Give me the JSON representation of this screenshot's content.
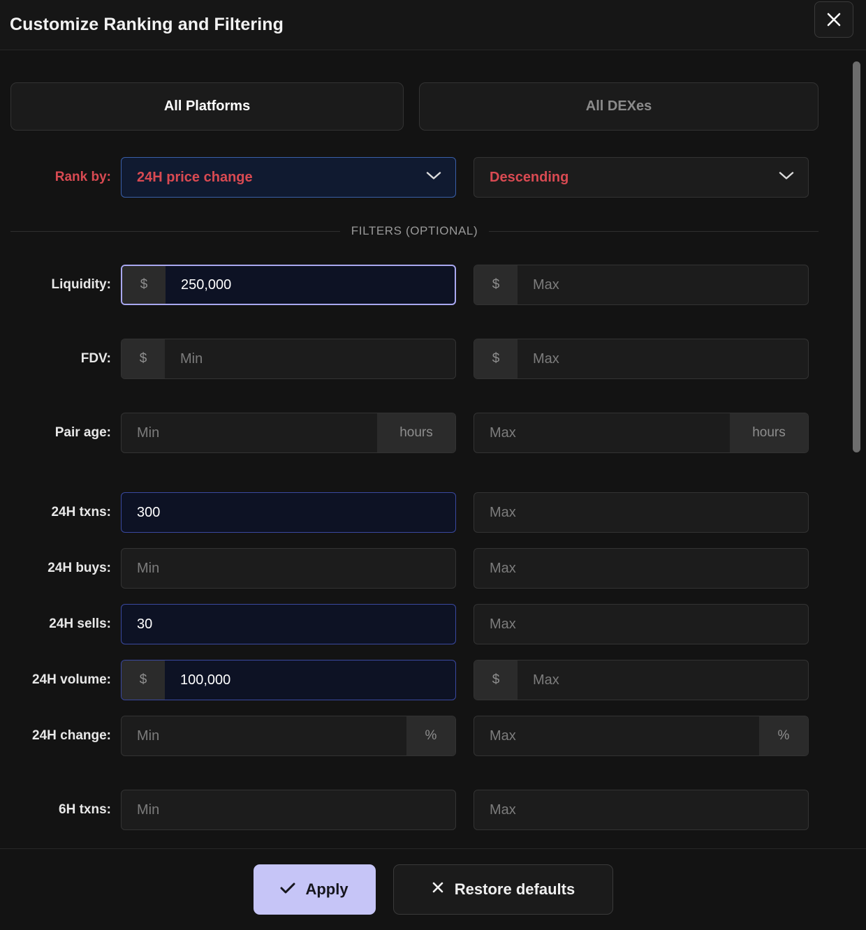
{
  "header": {
    "title": "Customize Ranking and Filtering",
    "close_icon": "close-icon"
  },
  "tabs": [
    {
      "label": "All Platforms",
      "selected": true
    },
    {
      "label": "All DEXes",
      "selected": false
    }
  ],
  "rank": {
    "label": "Rank by:",
    "metric_value": "24H price change",
    "direction_value": "Descending",
    "chevron_icon": "chevron-down-icon"
  },
  "filters_divider": "FILTERS (OPTIONAL)",
  "filters": [
    {
      "label": "Liquidity:",
      "min": {
        "prefix": "$",
        "value": "250,000",
        "placeholder": "Min",
        "state": "focused"
      },
      "max": {
        "prefix": "$",
        "value": "",
        "placeholder": "Max",
        "state": "empty"
      }
    },
    {
      "label": "FDV:",
      "min": {
        "prefix": "$",
        "value": "",
        "placeholder": "Min",
        "state": "empty"
      },
      "max": {
        "prefix": "$",
        "value": "",
        "placeholder": "Max",
        "state": "empty"
      }
    },
    {
      "label": "Pair age:",
      "min": {
        "suffix": "hours",
        "value": "",
        "placeholder": "Min",
        "state": "empty"
      },
      "max": {
        "suffix": "hours",
        "value": "",
        "placeholder": "Max",
        "state": "empty"
      }
    },
    {
      "label": "24H txns:",
      "min": {
        "value": "300",
        "placeholder": "Min",
        "state": "filled"
      },
      "max": {
        "value": "",
        "placeholder": "Max",
        "state": "empty"
      }
    },
    {
      "label": "24H buys:",
      "min": {
        "value": "",
        "placeholder": "Min",
        "state": "empty"
      },
      "max": {
        "value": "",
        "placeholder": "Max",
        "state": "empty"
      }
    },
    {
      "label": "24H sells:",
      "min": {
        "value": "30",
        "placeholder": "Min",
        "state": "filled"
      },
      "max": {
        "value": "",
        "placeholder": "Max",
        "state": "empty"
      }
    },
    {
      "label": "24H volume:",
      "min": {
        "prefix": "$",
        "value": "100,000",
        "placeholder": "Min",
        "state": "filled"
      },
      "max": {
        "prefix": "$",
        "value": "",
        "placeholder": "Max",
        "state": "empty"
      }
    },
    {
      "label": "24H change:",
      "min": {
        "suffix": "%",
        "value": "",
        "placeholder": "Min",
        "state": "empty"
      },
      "max": {
        "suffix": "%",
        "value": "",
        "placeholder": "Max",
        "state": "empty"
      }
    },
    {
      "label": "6H txns:",
      "min": {
        "value": "",
        "placeholder": "Min",
        "state": "empty"
      },
      "max": {
        "value": "",
        "placeholder": "Max",
        "state": "empty"
      }
    }
  ],
  "footer": {
    "apply_label": "Apply",
    "apply_icon": "check-icon",
    "restore_label": "Restore defaults",
    "restore_icon": "x-icon"
  },
  "colors": {
    "accent_red": "#d94a52",
    "apply_bg": "#c6c5f7",
    "focus_border": "#a9a8f0",
    "filled_bg": "#0d1224",
    "dialog_bg": "#131313"
  }
}
